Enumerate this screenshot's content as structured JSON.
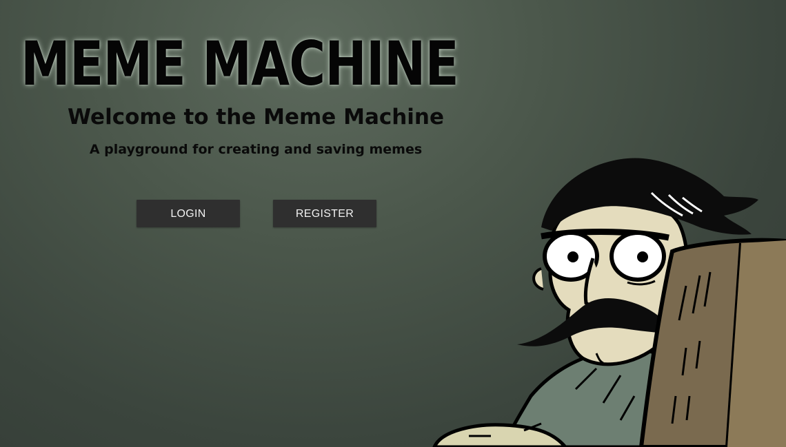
{
  "brand": {
    "title": "MEME MACHINE"
  },
  "hero": {
    "heading": "Welcome to the Meme Machine",
    "tagline": "A playground for creating and saving memes"
  },
  "actions": {
    "login_label": "LOGIN",
    "register_label": "REGISTER"
  },
  "colors": {
    "background": "#4b574b",
    "button_bg": "#2f2f2f",
    "button_text": "#f2f2f2",
    "heading_text": "#0a0a0a"
  },
  "illustration": {
    "name": "suspicious-mustache-man-meme"
  }
}
